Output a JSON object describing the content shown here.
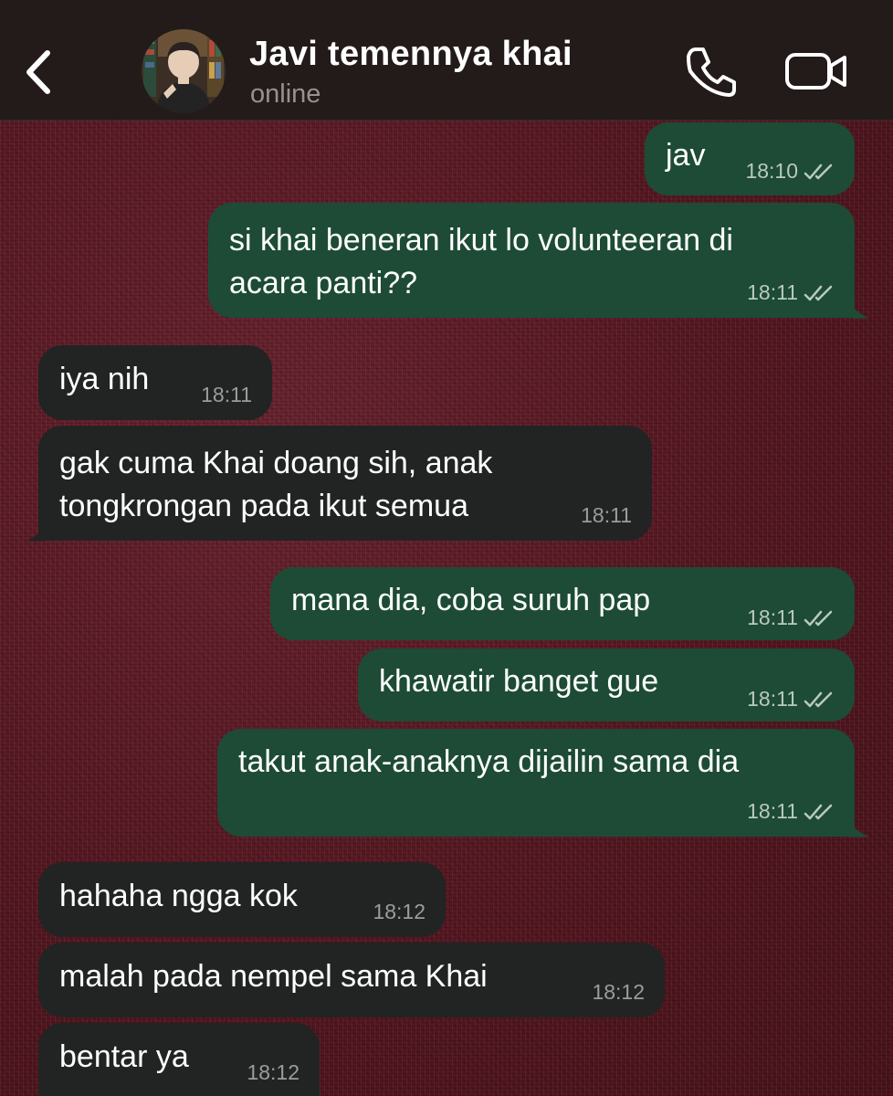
{
  "header": {
    "contact_name": "Javi temennya khai",
    "status": "online",
    "back_icon": "chevron-left-icon",
    "call_icon": "phone-icon",
    "video_icon": "video-camera-icon"
  },
  "colors": {
    "header_bg": "#231a1a",
    "outgoing_bubble": "#1d4b35",
    "incoming_bubble": "#222423",
    "wallpaper": "#5a1a22"
  },
  "messages": [
    {
      "direction": "outgoing",
      "lines": [
        "jav"
      ],
      "time": "18:10",
      "read": true
    },
    {
      "direction": "outgoing",
      "lines": [
        "si khai beneran ikut lo volunteeran di",
        "acara panti??"
      ],
      "time": "18:11",
      "read": true
    },
    {
      "direction": "incoming",
      "lines": [
        "iya nih"
      ],
      "time": "18:11"
    },
    {
      "direction": "incoming",
      "lines": [
        "gak cuma Khai doang sih, anak",
        "tongkrongan pada ikut semua"
      ],
      "time": "18:11"
    },
    {
      "direction": "outgoing",
      "lines": [
        "mana dia, coba suruh pap"
      ],
      "time": "18:11",
      "read": true
    },
    {
      "direction": "outgoing",
      "lines": [
        "khawatir banget gue"
      ],
      "time": "18:11",
      "read": true
    },
    {
      "direction": "outgoing",
      "lines": [
        "takut anak-anaknya dijailin sama dia"
      ],
      "time": "18:11",
      "read": true
    },
    {
      "direction": "incoming",
      "lines": [
        "hahaha ngga kok"
      ],
      "time": "18:12"
    },
    {
      "direction": "incoming",
      "lines": [
        "malah pada nempel sama Khai"
      ],
      "time": "18:12"
    },
    {
      "direction": "incoming",
      "lines": [
        "bentar ya"
      ],
      "time": "18:12"
    }
  ]
}
